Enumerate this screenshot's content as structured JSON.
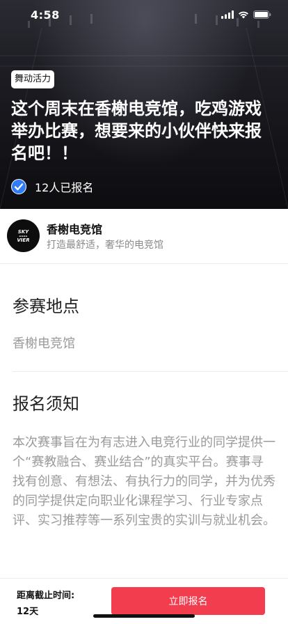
{
  "status_bar": {
    "time": "4:58"
  },
  "hero": {
    "tag": "舞动活力",
    "title": "这个周末在香榭电竞馆，吃鸡游戏举办比赛，想要来的小伙伴快来报名吧！！",
    "registered_text": "12人已报名"
  },
  "organizer": {
    "logo_text_1": "SKY",
    "logo_text_2": "VIER",
    "name": "香榭电竞馆",
    "description": "打造最舒适，奢华的电竞馆"
  },
  "venue": {
    "title": "参赛地点",
    "value": "香榭电竞馆"
  },
  "notice": {
    "title": "报名须知",
    "body": "本次赛事旨在为有志进入电竞行业的同学提供一个“赛教融合、赛业结合”的真实平台。赛事寻找有创意、有想法、有执行力的同学，并为优秀的同学提供定向职业化课程学习、行业专家点评、实习推荐等一系列宝贵的实训与就业机会。"
  },
  "footer": {
    "deadline_label": "距离截止时间:",
    "deadline_value": "12天",
    "signup_label": "立即报名"
  },
  "colors": {
    "accent": "#f13d4e",
    "check": "#2f7cf6"
  },
  "icons": [
    "signal-icon",
    "wifi-icon",
    "battery-icon",
    "check-circle-icon"
  ]
}
